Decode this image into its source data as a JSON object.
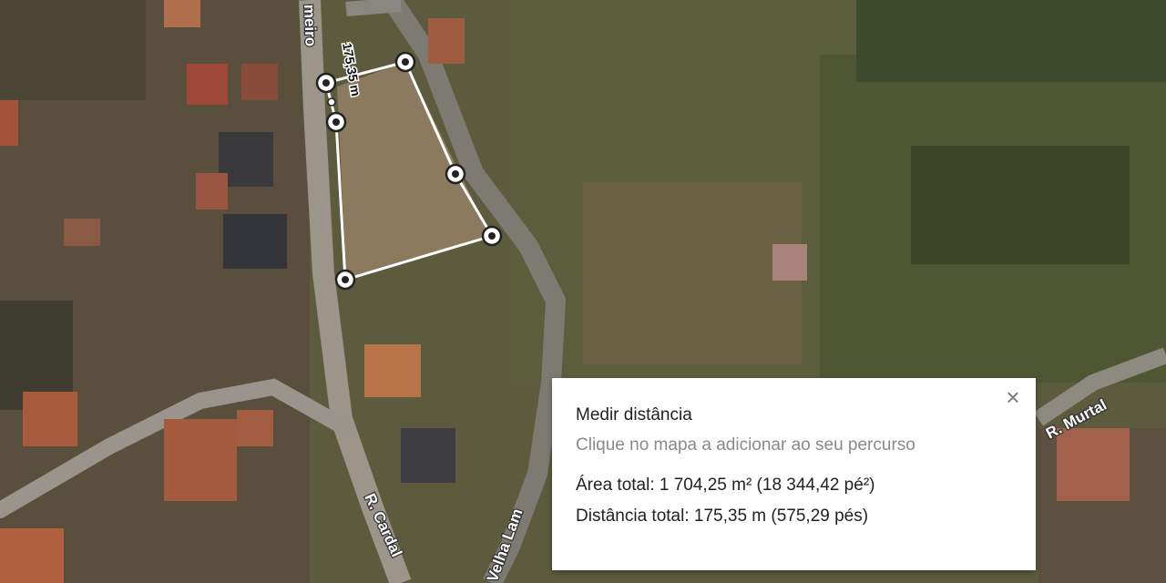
{
  "map": {
    "roads": [
      "meiro",
      "R. Cardal",
      "Velha Lam",
      "R. Murtal"
    ],
    "measure_label": "175,35 m"
  },
  "panel": {
    "title": "Medir distância",
    "hint": "Clique no mapa a adicionar ao seu percurso",
    "area": "Área total: 1 704,25 m² (18 344,42 pé²)",
    "distance": "Distância total: 175,35 m (575,29 pés)",
    "close_icon": "close-icon"
  }
}
